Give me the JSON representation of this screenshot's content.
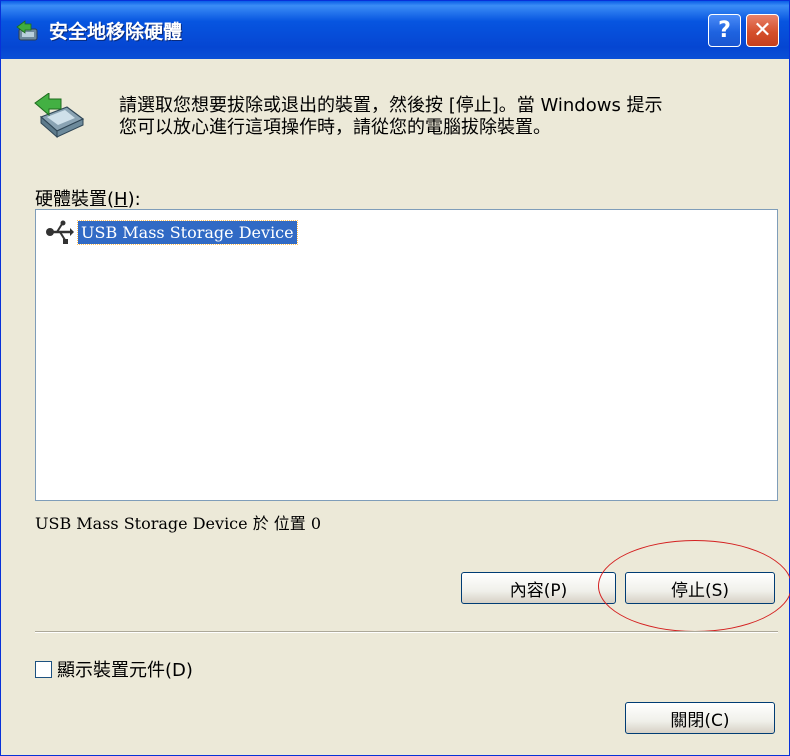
{
  "window": {
    "title": "安全地移除硬體",
    "help_label": "?",
    "close_label": "✕"
  },
  "instructions": "請選取您想要拔除或退出的裝置，然後按 [停止]。當 Windows 提示\n您可以放心進行這項操作時，請從您的電腦拔除裝置。",
  "hardware_devices": {
    "label_prefix": "硬體裝置(",
    "accesskey": "H",
    "label_suffix": "):",
    "items": [
      {
        "name": "USB Mass Storage Device",
        "icon": "usb-icon",
        "selected": true
      }
    ]
  },
  "location_text": "USB Mass Storage Device 於 位置 0",
  "buttons": {
    "properties": "內容(P)",
    "stop": "停止(S)",
    "close": "關閉(C)"
  },
  "show_components": {
    "label": "顯示裝置元件(D)",
    "checked": false
  },
  "colors": {
    "titlebar": "#0546d2",
    "selection": "#316ac5",
    "annotation": "#d42020"
  }
}
